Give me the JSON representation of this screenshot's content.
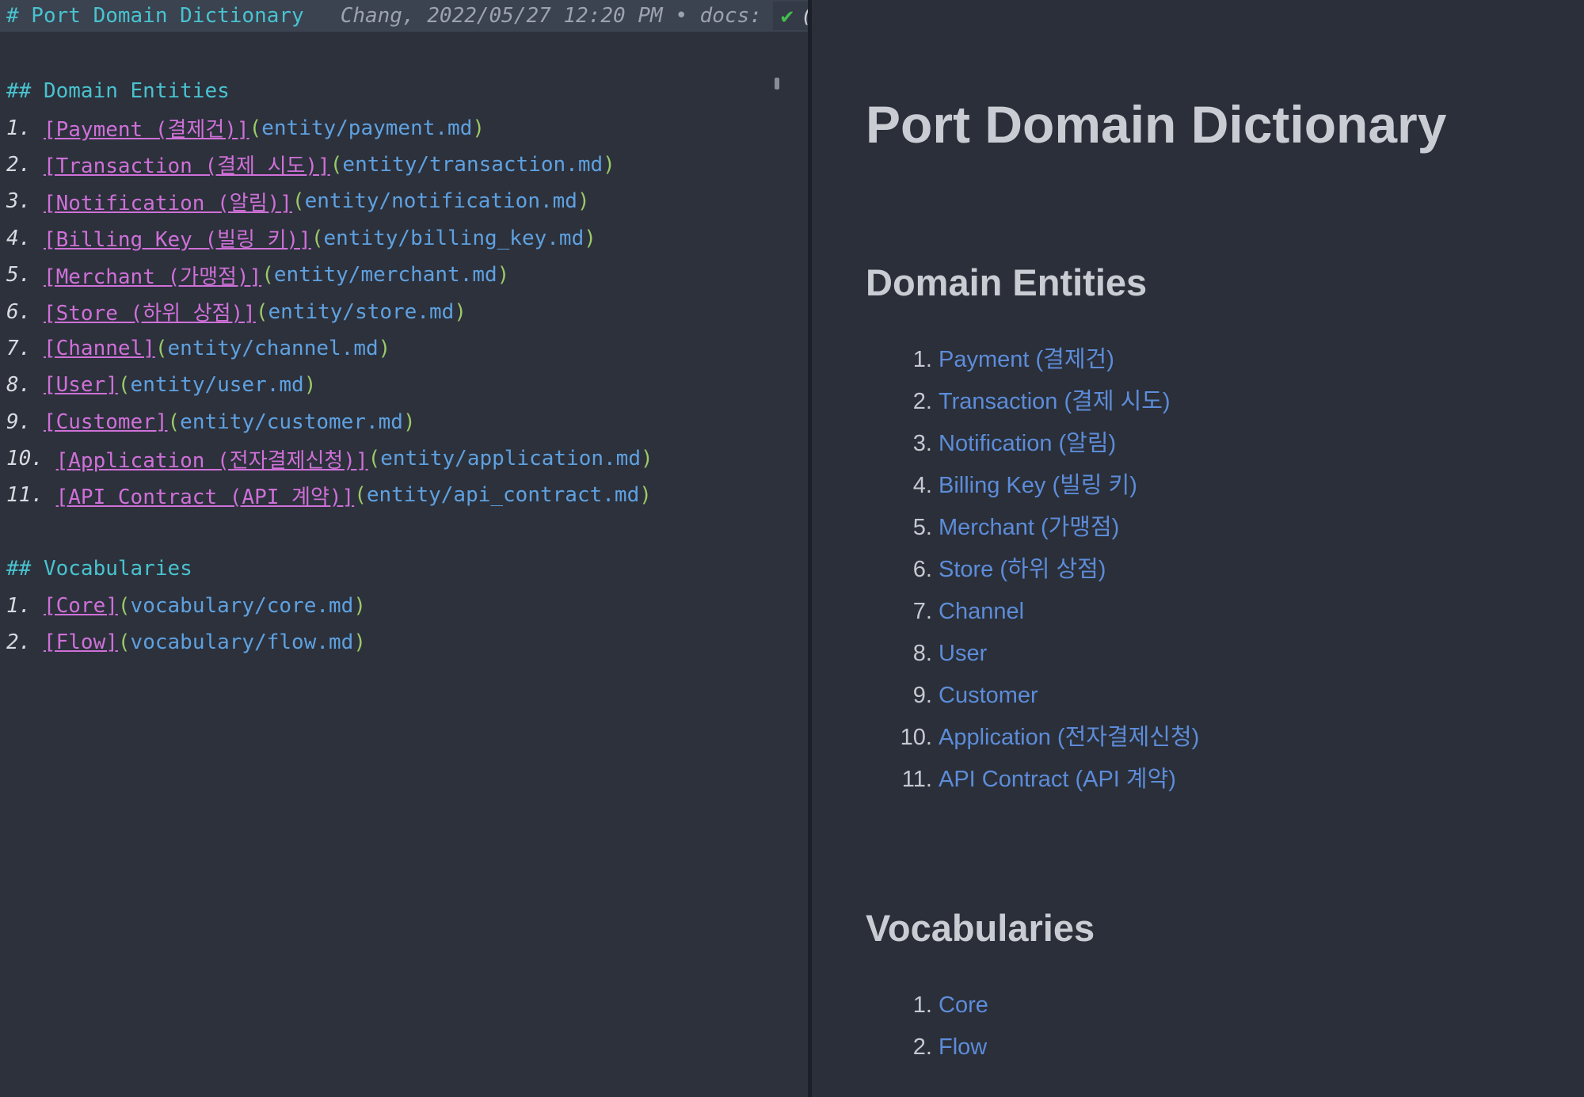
{
  "theme": {
    "editor_bg": "#2c313c",
    "topbar_bg": "#3b4250",
    "preview_bg": "#2a2f39",
    "divider": "#1b1f27",
    "heading_cyan": "#49c3cf",
    "link_magenta": "#cf70d8",
    "url_blue": "#5fa1e0",
    "paren_green": "#9cc968",
    "list_number_light": "#d8dbe0",
    "meta_gray": "#9da3ae",
    "check_green": "#43bd4f",
    "preview_heading_gray": "#c9cdd3",
    "preview_link_blue": "#5d8cd9"
  },
  "editor": {
    "topbar": {
      "title": "# Port Domain Dictionary",
      "meta": "Chang, 2022/05/27 12:20 PM • docs:",
      "check_icon": "✔",
      "clipped_glyph": "("
    },
    "syntax": {
      "open_paren": "(",
      "close_paren": ")"
    },
    "sections": [
      {
        "heading": "## Domain Entities",
        "items": [
          {
            "prefix": "1. ",
            "label": "[Payment (결제건)]",
            "url": "entity/payment.md"
          },
          {
            "prefix": "2. ",
            "label": "[Transaction (결제 시도)]",
            "url": "entity/transaction.md"
          },
          {
            "prefix": "3. ",
            "label": "[Notification (알림)]",
            "url": "entity/notification.md"
          },
          {
            "prefix": "4. ",
            "label": "[Billing Key (빌링 키)]",
            "url": "entity/billing_key.md"
          },
          {
            "prefix": "5. ",
            "label": "[Merchant (가맹점)]",
            "url": "entity/merchant.md"
          },
          {
            "prefix": "6. ",
            "label": "[Store (하위 상점)]",
            "url": "entity/store.md"
          },
          {
            "prefix": "7. ",
            "label": "[Channel]",
            "url": "entity/channel.md"
          },
          {
            "prefix": "8. ",
            "label": "[User]",
            "url": "entity/user.md"
          },
          {
            "prefix": "9. ",
            "label": "[Customer]",
            "url": "entity/customer.md"
          },
          {
            "prefix": "10. ",
            "label": "[Application (전자결제신청)]",
            "url": "entity/application.md"
          },
          {
            "prefix": "11. ",
            "label": "[API Contract (API 계약)]",
            "url": "entity/api_contract.md"
          }
        ]
      },
      {
        "heading": "## Vocabularies",
        "items": [
          {
            "prefix": "1. ",
            "label": "[Core]",
            "url": "vocabulary/core.md"
          },
          {
            "prefix": "2. ",
            "label": "[Flow]",
            "url": "vocabulary/flow.md"
          }
        ]
      }
    ]
  },
  "preview": {
    "title": "Port Domain Dictionary",
    "sections": [
      {
        "heading": "Domain Entities",
        "items": [
          "Payment (결제건)",
          "Transaction (결제 시도)",
          "Notification (알림)",
          "Billing Key (빌링 키)",
          "Merchant (가맹점)",
          "Store (하위 상점)",
          "Channel",
          "User",
          "Customer",
          "Application (전자결제신청)",
          "API Contract (API 계약)"
        ]
      },
      {
        "heading": "Vocabularies",
        "items": [
          "Core",
          "Flow"
        ]
      }
    ]
  }
}
